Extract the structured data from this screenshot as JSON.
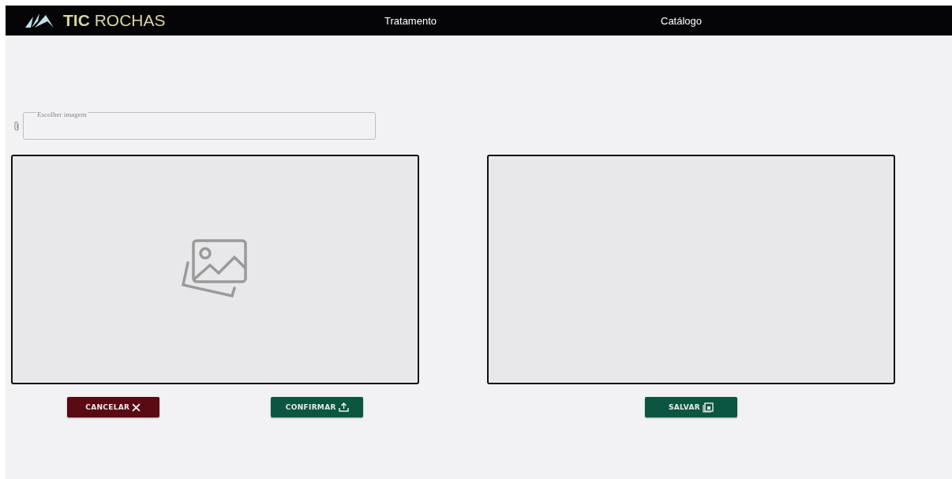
{
  "header": {
    "logo_text_bold": "TIC",
    "logo_text": "ROCHAS",
    "nav": [
      {
        "label": "Tratamento"
      },
      {
        "label": "Catálogo"
      }
    ]
  },
  "file_field": {
    "label": "Escolher imagem"
  },
  "buttons": [
    {
      "kind": "cancel",
      "label": "CANCELAR"
    },
    {
      "kind": "confirm",
      "label": "CONFIRMAR"
    },
    {
      "kind": "save",
      "label": "SALVAR"
    }
  ]
}
